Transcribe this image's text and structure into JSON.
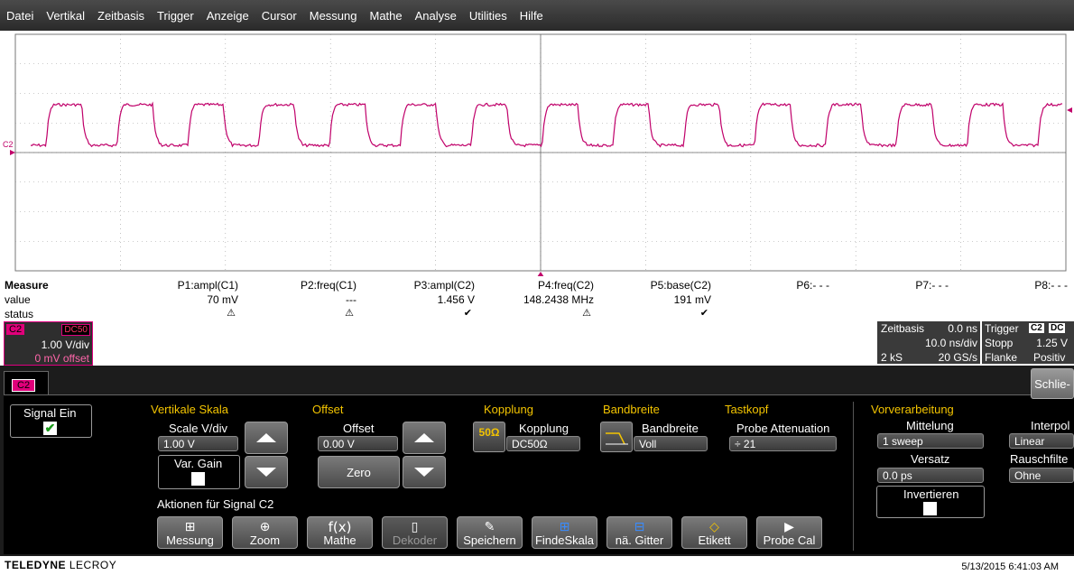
{
  "menu": [
    "Datei",
    "Vertikal",
    "Zeitbasis",
    "Trigger",
    "Anzeige",
    "Cursor",
    "Messung",
    "Mathe",
    "Analyse",
    "Utilities",
    "Hilfe"
  ],
  "colors": {
    "trace": "#c0006a",
    "accent": "#f3c400",
    "channel": "#e0007a"
  },
  "grid": {
    "channel_marker": "C2"
  },
  "measure": {
    "row_labels": [
      "Measure",
      "value",
      "status"
    ],
    "params": [
      {
        "label": "P1:ampl(C1)",
        "value": "70 mV",
        "status": "status-warn-icon"
      },
      {
        "label": "P2:freq(C1)",
        "value": "---",
        "status": "status-warn-icon"
      },
      {
        "label": "P3:ampl(C2)",
        "value": "1.456 V",
        "status": "check-icon"
      },
      {
        "label": "P4:freq(C2)",
        "value": "148.2438 MHz",
        "status": "status-warn-icon"
      },
      {
        "label": "P5:base(C2)",
        "value": "191 mV",
        "status": "check-icon"
      },
      {
        "label": "P6:- - -",
        "value": "",
        "status": ""
      },
      {
        "label": "P7:- - -",
        "value": "",
        "status": ""
      },
      {
        "label": "P8:- - -",
        "value": "",
        "status": ""
      }
    ]
  },
  "channel_box": {
    "tag": "C2",
    "coupling": "DC50",
    "vdiv": "1.00 V/div",
    "offset": "0 mV offset"
  },
  "timebase": {
    "title": "Zeitbasis",
    "delay": "0.0 ns",
    "tdiv": "10.0 ns/div",
    "samples": "2 kS",
    "rate": "20 GS/s"
  },
  "trigger": {
    "title": "Trigger",
    "src": "C2",
    "cpl": "DC",
    "mode": "Stopp",
    "level": "1.25 V",
    "type": "Flanke",
    "slope": "Positiv"
  },
  "panel": {
    "tab": "C2",
    "close": "Schlie-",
    "signal_on": "Signal Ein",
    "vert_scale": "Vertikale Skala",
    "scale_label": "Scale V/div",
    "scale_value": "1.00 V",
    "var_gain": "Var. Gain",
    "offset_title": "Offset",
    "offset_label": "Offset",
    "offset_value": "0.00 V",
    "zero": "Zero",
    "coupling_title": "Kopplung",
    "coupling_label": "Kopplung",
    "coupling_value": "DC50Ω",
    "coupling_icon": "50Ω",
    "bw_title": "Bandbreite",
    "bw_label": "Bandbreite",
    "bw_value": "Voll",
    "probe_title": "Tastkopf",
    "probe_label": "Probe Attenuation",
    "probe_value": "÷   21",
    "actions_title": "Aktionen für Signal C2",
    "actions": [
      "Messung",
      "Zoom",
      "Mathe",
      "Dekoder",
      "Speichern",
      "FindeSkala",
      "nä. Gitter",
      "Etikett",
      "Probe Cal"
    ],
    "pre_title": "Vorverarbeitung",
    "avg_label": "Mittelung",
    "avg_value": "1 sweep",
    "interp_label": "Interpol",
    "interp_value": "Linear",
    "skew_label": "Versatz",
    "skew_value": "0.0 ps",
    "noise_label": "Rauschfilte",
    "noise_value": "Ohne",
    "invert_label": "Invertieren"
  },
  "footer": {
    "brand_bold": "TELEDYNE",
    "brand_light": "LECROY",
    "datetime": "5/13/2015 6:41:03 AM"
  }
}
